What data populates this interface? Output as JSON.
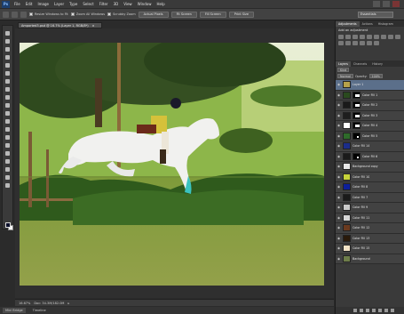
{
  "app": {
    "logo": "Ps"
  },
  "menu": [
    "File",
    "Edit",
    "Image",
    "Layer",
    "Type",
    "Select",
    "Filter",
    "3D",
    "View",
    "Window",
    "Help"
  ],
  "options": {
    "resize_windows": "Resize Windows to Fit",
    "zoom_all": "Zoom All Windows",
    "scrubby_zoom": "Scrubby Zoom",
    "actual_pixels": "Actual Pixels",
    "fit_screen": "Fit Screen",
    "fill_screen": "Fill Screen",
    "print_size": "Print Size",
    "workspace": "Essentials"
  },
  "document": {
    "tab_title": "Amported3.psd @ 16.7% (Layer 1, RGB/8*)",
    "zoom": "16.67%",
    "doc_info": "Doc: 34.3M/182.0M"
  },
  "bottom_tabs": {
    "mini_bridge": "Mini Bridge",
    "timeline": "Timeline"
  },
  "adjustments": {
    "tabs": [
      "Adjustments",
      "Actions",
      "Histogram"
    ],
    "title": "Add an adjustment"
  },
  "layers": {
    "tabs": [
      "Layers",
      "Channels",
      "History"
    ],
    "kind_filter": "Kind",
    "blend_mode": "Normal",
    "opacity_label": "Opacity:",
    "opacity_value": "100%",
    "lock_label": "Lock:",
    "fill_label": "Fill:",
    "fill_value": "100%",
    "items": [
      {
        "name": "Layer 1",
        "thumb": "#b5a14a",
        "mask": "none"
      },
      {
        "name": "Color Fill 1",
        "thumb": "#2a4a1e",
        "mask": "blob"
      },
      {
        "name": "Color Fill 2",
        "thumb": "#1a1a1a",
        "mask": "blob"
      },
      {
        "name": "Color Fill 3",
        "thumb": "#1e1e1e",
        "mask": "blob"
      },
      {
        "name": "Color Fill 4",
        "thumb": "#ffffff",
        "mask": "blob"
      },
      {
        "name": "Color Fill 5",
        "thumb": "#2e6b2a",
        "mask": "dot"
      },
      {
        "name": "Color Fill 14",
        "thumb": "#1b2d8a",
        "mask": "none"
      },
      {
        "name": "Color Fill 6",
        "thumb": "#1a1a1a",
        "mask": "dot"
      },
      {
        "name": "Background copy",
        "thumb": "#e8e8e8",
        "mask": "none"
      },
      {
        "name": "Color Fill 10",
        "thumb": "#c6d23a",
        "mask": "none"
      },
      {
        "name": "Color Fill 8",
        "thumb": "#0d1f9a",
        "mask": "none"
      },
      {
        "name": "Color Fill 7",
        "thumb": "#1a1a1a",
        "mask": "none"
      },
      {
        "name": "Color Fill 9",
        "thumb": "#c9c9c9",
        "mask": "none"
      },
      {
        "name": "Color Fill 11",
        "thumb": "#d6d6d6",
        "mask": "none"
      },
      {
        "name": "Color Fill 12",
        "thumb": "#6b3a1e",
        "mask": "none"
      },
      {
        "name": "Color Fill 13",
        "thumb": "#2a1a0a",
        "mask": "none"
      },
      {
        "name": "Color Fill 15",
        "thumb": "#f3e3c6",
        "mask": "none"
      },
      {
        "name": "Background",
        "thumb": "#6e7d4a",
        "mask": "none"
      }
    ]
  }
}
